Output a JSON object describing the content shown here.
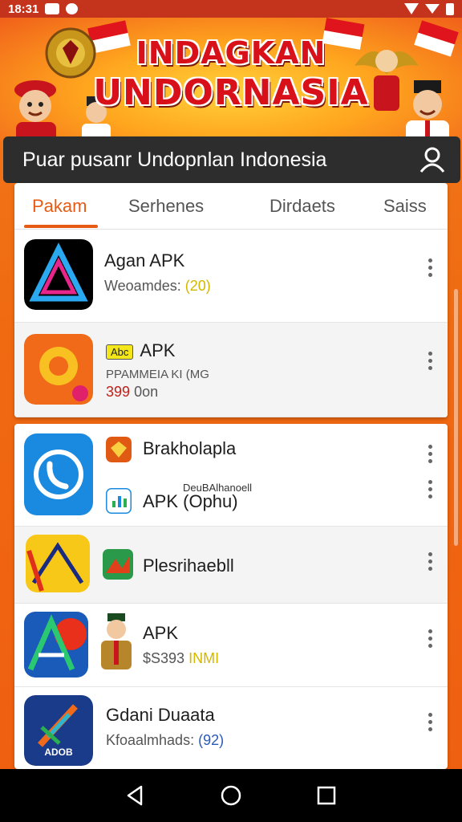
{
  "status_bar": {
    "time": "18:31"
  },
  "banner": {
    "title_line1": "INDAGKAN",
    "title_line2": "UNDORNASIA"
  },
  "search": {
    "text": "Puar pusanr Undopnlan Indonesia"
  },
  "tabs": [
    {
      "label": "Pakam",
      "active": true
    },
    {
      "label": "Serhenes",
      "active": false
    },
    {
      "label": "Dirdaets",
      "active": false
    },
    {
      "label": "Saiss",
      "active": false
    }
  ],
  "apps_top": [
    {
      "title": "Agan APK",
      "sub_prefix": "Weoamdes:",
      "sub_value": "(20)",
      "icon": "triangle-logo-icon"
    },
    {
      "badge": "Abc",
      "title": "APK",
      "sub1": "PPAMMEIA KI (MG",
      "price": "399",
      "price_suffix": "0on",
      "icon": "orange-circle-icon"
    }
  ],
  "apps_bottom": [
    {
      "title": "Brakholapla",
      "icon": "phone-icon",
      "mini_icon": "eagle-icon"
    },
    {
      "title": "APK (Ophu)",
      "note": "DeuBAlhanoell",
      "mini_icon": "chart-icon"
    },
    {
      "title": "Plesrihaebll",
      "icon": "yellow-app-icon",
      "mini_icon": "mountain-icon"
    },
    {
      "title": "APK",
      "sub_prefix": "$S393",
      "sub_value": "INMI",
      "icon": "blue-a-icon",
      "mini_icon": "man-avatar-icon"
    },
    {
      "title": "Gdani Duaata",
      "sub_prefix": "Kfoaalmhads:",
      "sub_value": "(92)",
      "icon": "arrow-icon",
      "icon_label": "ADOB"
    }
  ],
  "colors": {
    "accent": "#e65a14",
    "search_bg": "#2d2d2d",
    "banner_red": "#d8101a"
  }
}
